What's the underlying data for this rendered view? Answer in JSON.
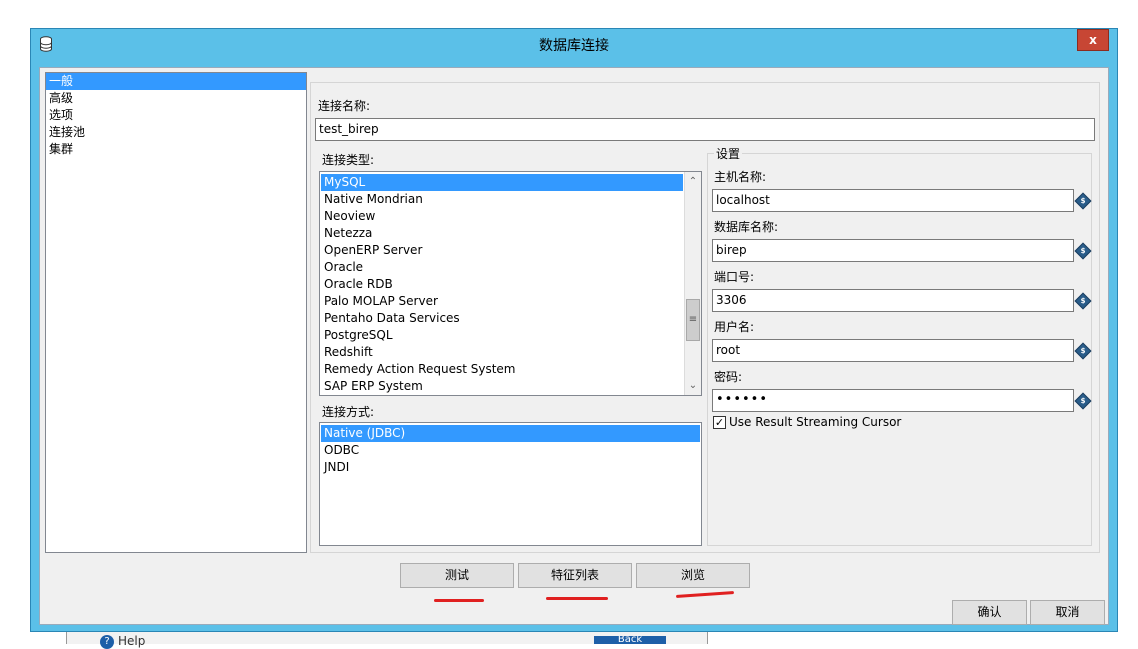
{
  "window": {
    "title": "数据库连接",
    "close_label": "x"
  },
  "sidebar": {
    "items": [
      {
        "label": "一般",
        "selected": true
      },
      {
        "label": "高级",
        "selected": false
      },
      {
        "label": "选项",
        "selected": false
      },
      {
        "label": "连接池",
        "selected": false
      },
      {
        "label": "集群",
        "selected": false
      }
    ]
  },
  "general": {
    "connection_name_label": "连接名称:",
    "connection_name_value": "test_birep",
    "connection_type_label": "连接类型:",
    "connection_types": [
      "MySQL",
      "Native Mondrian",
      "Neoview",
      "Netezza",
      "OpenERP Server",
      "Oracle",
      "Oracle RDB",
      "Palo MOLAP Server",
      "Pentaho Data Services",
      "PostgreSQL",
      "Redshift",
      "Remedy Action Request System",
      "SAP ERP System"
    ],
    "selected_connection_type": "MySQL",
    "access_label": "连接方式:",
    "access_methods": [
      "Native (JDBC)",
      "ODBC",
      "JNDI"
    ],
    "selected_access_method": "Native (JDBC)"
  },
  "settings": {
    "group_title": "设置",
    "host_label": "主机名称:",
    "host_value": "localhost",
    "db_label": "数据库名称:",
    "db_value": "birep",
    "port_label": "端口号:",
    "port_value": "3306",
    "user_label": "用户名:",
    "user_value": "root",
    "password_label": "密码:",
    "password_value": "••••••",
    "streaming_label": "Use Result Streaming Cursor",
    "streaming_checked": true,
    "variable_icon_glyph": "$"
  },
  "buttons": {
    "test": "测试",
    "features": "特征列表",
    "explore": "浏览",
    "ok": "确认",
    "cancel": "取消"
  },
  "background": {
    "help_label": "Help",
    "back_label": "Back"
  },
  "colors": {
    "title_bar": "#5bc0e8",
    "selection": "#3399ff",
    "close": "#c74634",
    "annotation": "#e02020"
  }
}
